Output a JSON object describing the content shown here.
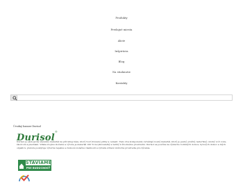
{
  "nav": {
    "items": [
      {
        "label": "Produkty"
      },
      {
        "label": "Predajné miesta"
      },
      {
        "label": "Akcie"
      },
      {
        "label": "Inšpirácia"
      },
      {
        "label": "Blog"
      },
      {
        "label": "Na stiahnutie"
      },
      {
        "label": "Kontakty"
      }
    ]
  },
  "search": {
    "icon": "search-icon",
    "placeholder": ""
  },
  "banner": {
    "alt_text": "Úvodný banner Durisol",
    "logo_text": "Durisol",
    "logo_mark": "®",
    "brand_color": "#2f7a3b"
  },
  "description": "Durisol je ekologický stavebný materiál na prírodnej báze, ktorý tvorí drevené piliny a cement. Tieto dva komponenty vytvárajú nosný materiál, ktorý je pevný, pružný, nehorľavý, odolný voči vode, škodcom a plesniam. Vďaka svojmu zloženiu a výrobe je materiál 100 % recyklovateľný a šetrný k životnému prostrediu. Durisol sa používa na výstavbu rodinných domov, bytových domov a iných objektov, pretože poskytuje výborné tepelné a zvukové izolačné vlastnosti a vytvára zdravé vnútorné prostredie pre bývanie.",
  "badge": {
    "top": "STAVIAME",
    "bottom": "PRE BUDÚCNOSŤ",
    "accent": "#2f8a4a"
  }
}
